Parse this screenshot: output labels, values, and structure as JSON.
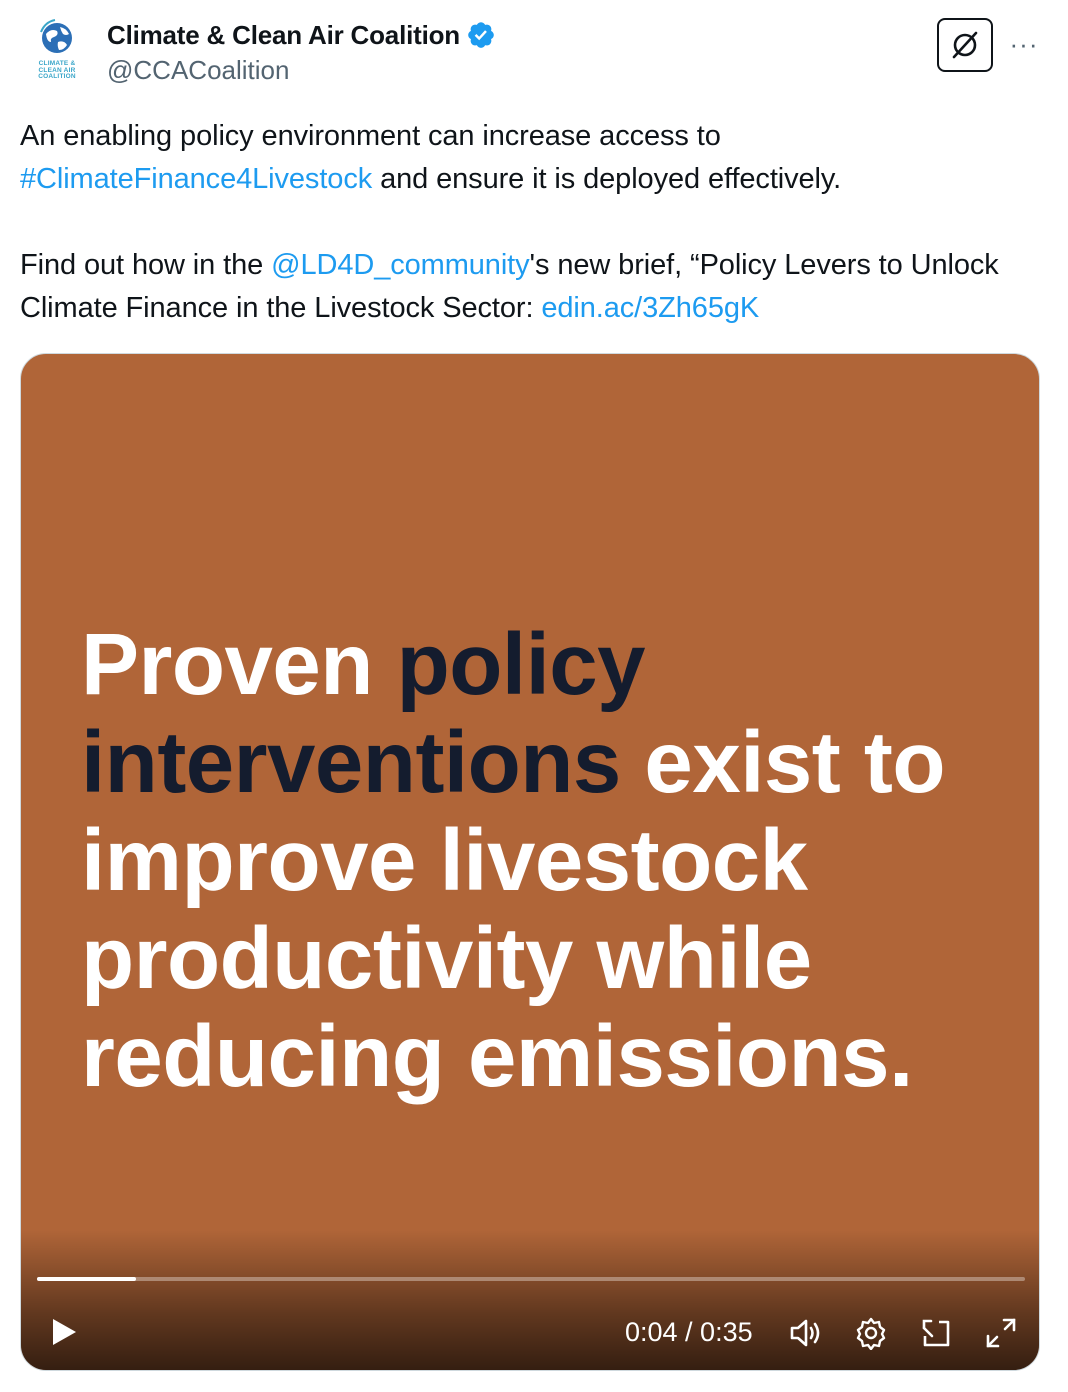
{
  "author": {
    "display_name": "Climate & Clean Air Coalition",
    "handle": "@CCACoalition",
    "verified": true,
    "avatar_logo_lines": [
      "CLIMATE &",
      "CLEAN AIR",
      "COALITION"
    ]
  },
  "actions": {
    "grok_icon": "grok-icon",
    "more_label": "···"
  },
  "post": {
    "line1_text": "An enabling policy environment can increase access to",
    "hashtag": "#ClimateFinance4Livestock",
    "line2_rest": " and ensure it is deployed effectively.",
    "para2_prefix": "Find out how in the ",
    "mention": "@LD4D_community",
    "para2_mid": "'s new brief, “Policy Levers to Unlock Climate Finance in the Livestock Sector: ",
    "url": "edin.ac/3Zh65gK"
  },
  "video": {
    "word1": "Proven ",
    "word_dark1": "policy",
    "word_dark2": "interventions",
    "rest1": " exist to",
    "line3": "improve livestock",
    "line4": "productivity while",
    "line5": "reducing emissions.",
    "background_color": "#b06538",
    "progress_fraction": 0.1,
    "time_display": "0:04 / 0:35"
  },
  "colors": {
    "link": "#1d9bf0",
    "verified_badge": "#1d9bf0",
    "dark_text": "#141c2e"
  }
}
